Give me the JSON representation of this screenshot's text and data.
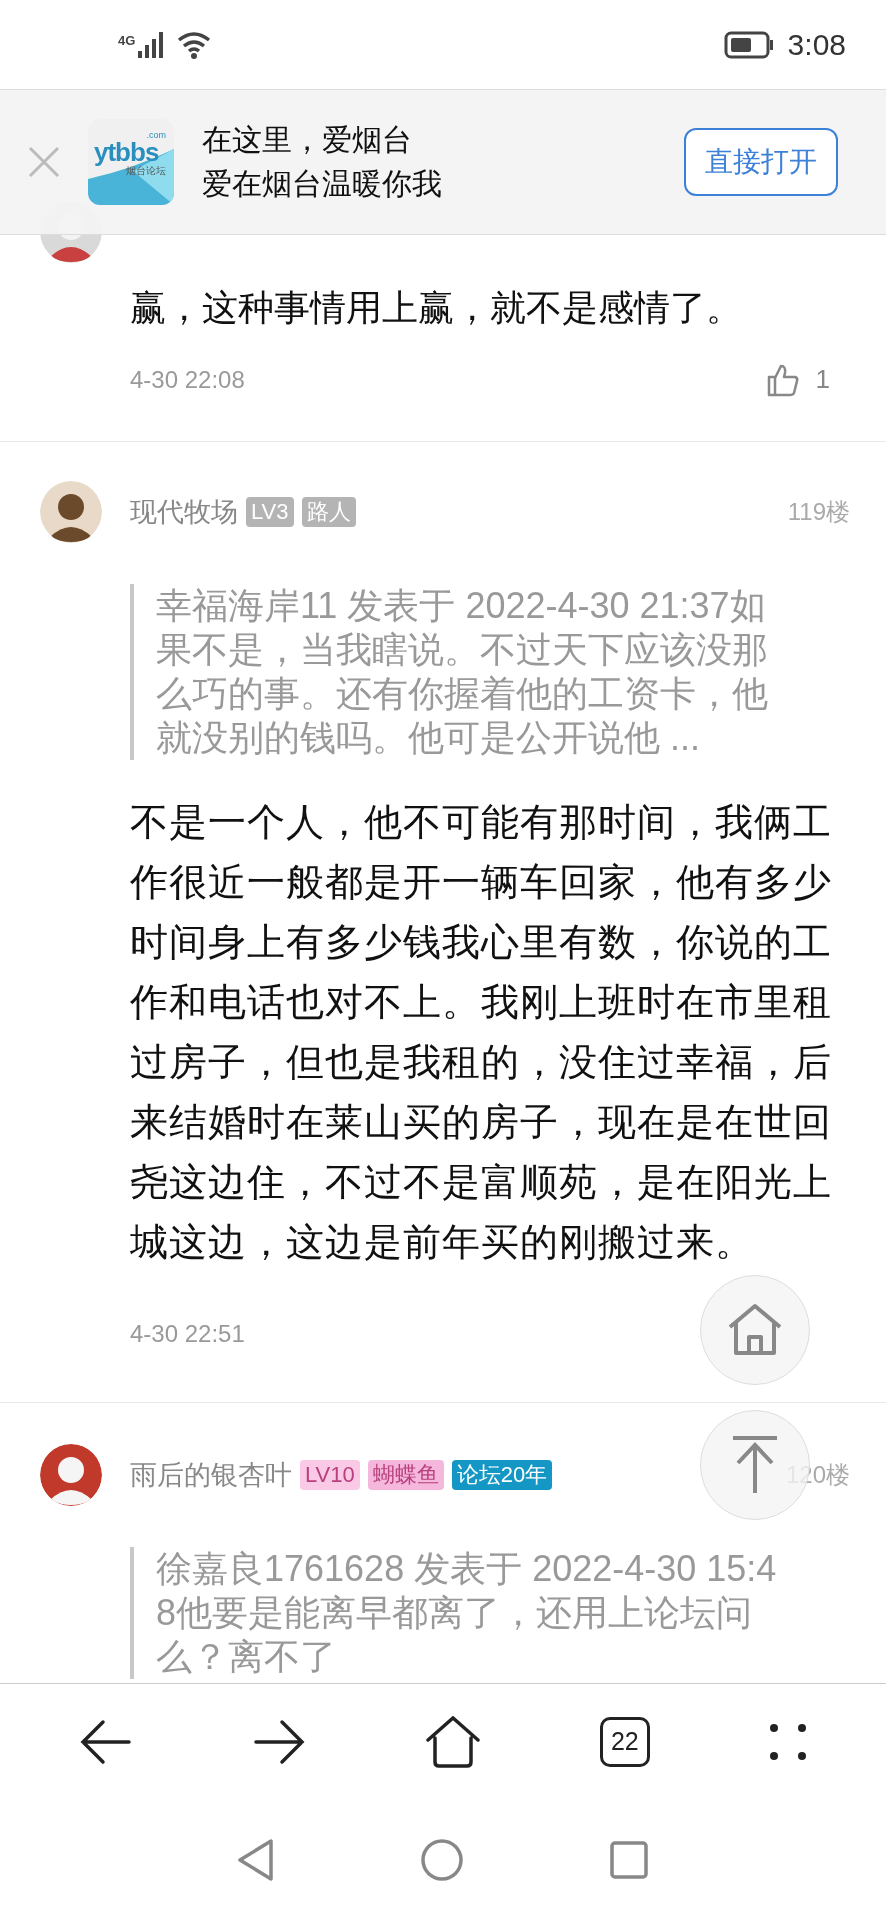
{
  "status_bar": {
    "network": "4G",
    "time": "3:08"
  },
  "app_banner": {
    "logo_text": "ytbbs",
    "logo_domain": ".com",
    "logo_caption": "烟台论坛",
    "line1": "在这里，爱烟台",
    "line2": "爱在烟台温暖你我",
    "open_button": "直接打开"
  },
  "posts": [
    {
      "text": "赢，这种事情用上赢，就不是感情了。",
      "date": "4-30 22:08",
      "likes": "1"
    },
    {
      "name": "现代牧场",
      "badges": [
        {
          "label": "LV3",
          "color": "#b4b4b4"
        },
        {
          "label": "路人",
          "color": "#b4b4b4"
        }
      ],
      "floor": "119楼",
      "quote": "幸福海岸11 发表于 2022-4-30 21:37如果不是，当我瞎说。不过天下应该没那么巧的事。还有你握着他的工资卡，他就没别的钱吗。他可是公开说他 ...",
      "text": "不是一个人，他不可能有那时间，我俩工作很近一般都是开一辆车回家，他有多少时间身上有多少钱我心里有数，你说的工作和电话也对不上。我刚上班时在市里租过房子，但也是我租的，没住过幸福，后来结婚时在莱山买的房子，现在是在世回尧这边住，不过不是富顺苑，是在阳光上城这边，这边是前年买的刚搬过来。",
      "date": "4-30 22:51"
    },
    {
      "name": "雨后的银杏叶",
      "badges": [
        {
          "label": "LV10",
          "color": "#f9c9e5"
        },
        {
          "label": "蝴蝶鱼",
          "color": "#f6b7dc"
        },
        {
          "label": "论坛20年",
          "color": "#1597c5"
        }
      ],
      "floor": "120楼",
      "quote": "徐嘉良1761628 发表于 2022-4-30 15:48他要是能离早都离了，还用上论坛问么？离不了"
    }
  ],
  "browser_bar": {
    "tab_count": "22"
  }
}
